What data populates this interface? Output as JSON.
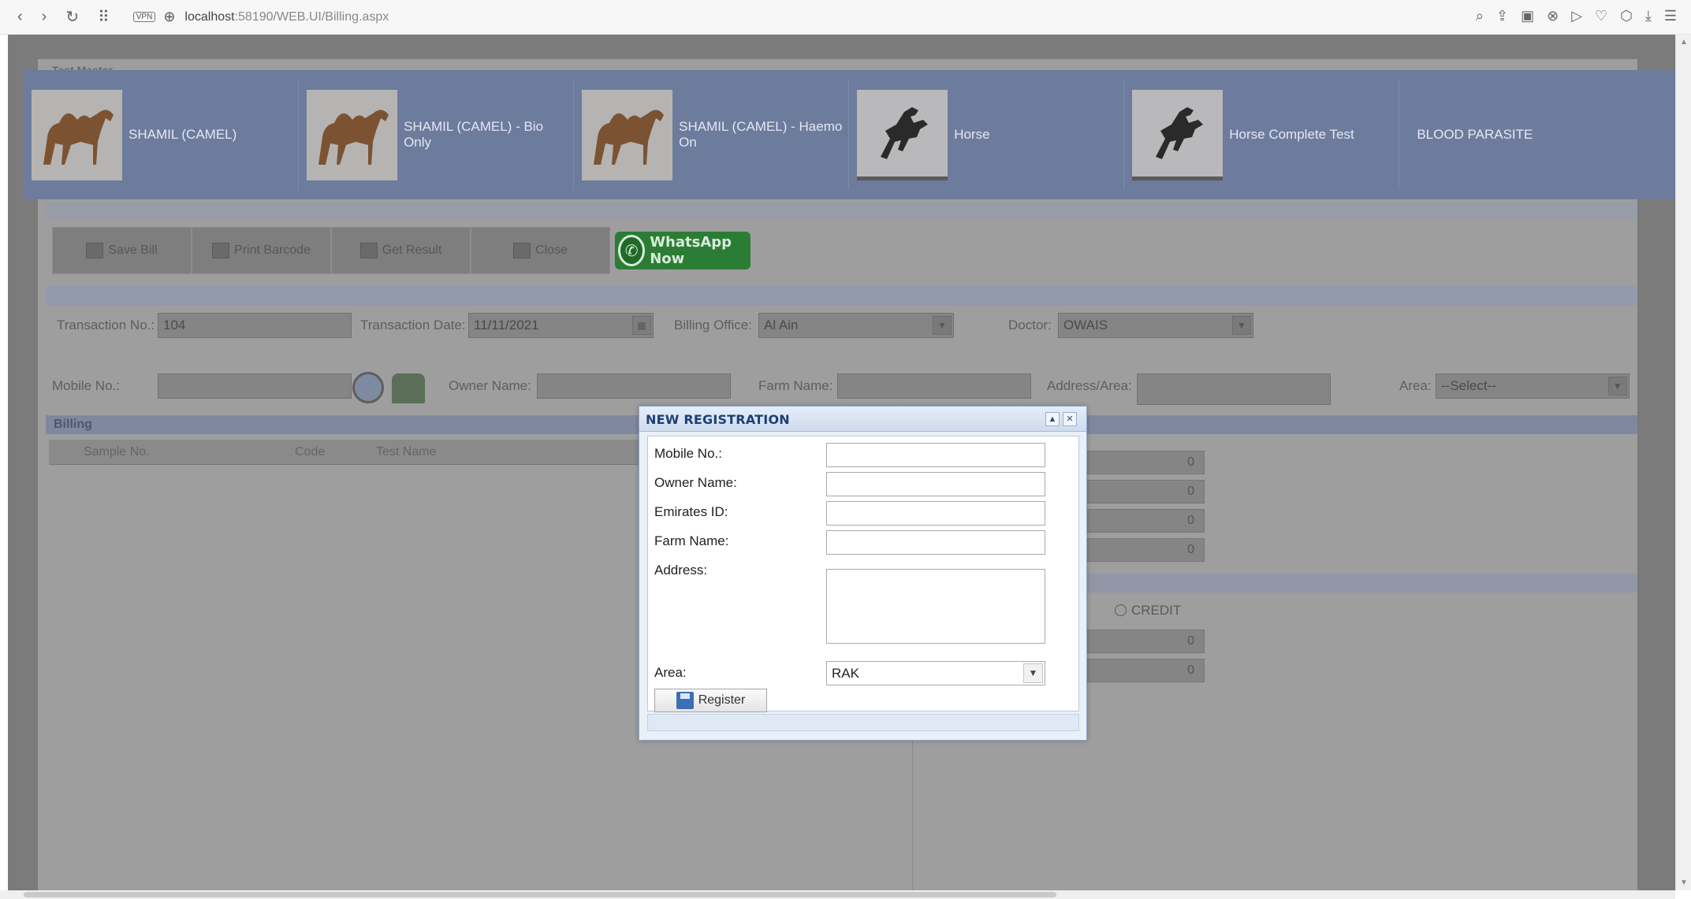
{
  "browser": {
    "url_host": "localhost",
    "url_rest": ":58190/WEB.UI/Billing.aspx",
    "vpn_label": "VPN"
  },
  "panel_title": "Test Master",
  "tests": [
    {
      "label": "SHAMIL (CAMEL)",
      "icon": "camel-image"
    },
    {
      "label": "SHAMIL (CAMEL) - Bio Only",
      "icon": "camel-image"
    },
    {
      "label": "SHAMIL (CAMEL) - Haemo On",
      "icon": "camel-image"
    },
    {
      "label": "Horse",
      "icon": "horse-image"
    },
    {
      "label": "Horse Complete Test",
      "icon": "horse-image"
    },
    {
      "label": "BLOOD PARASITE",
      "icon": ""
    }
  ],
  "toolbar": {
    "save": "Save Bill",
    "print": "Print Barcode",
    "result": "Get Result",
    "close": "Close",
    "whatsapp": "WhatsApp Now"
  },
  "form": {
    "transaction_no_label": "Transaction No.:",
    "transaction_no": "104",
    "transaction_date_label": "Transaction Date:",
    "transaction_date": "11/11/2021",
    "billing_office_label": "Billing Office:",
    "billing_office": "Al Ain",
    "doctor_label": "Doctor:",
    "doctor": "OWAIS",
    "mobile_label": "Mobile No.:",
    "owner_label": "Owner Name:",
    "farm_label": "Farm Name:",
    "address_label": "Address/Area:",
    "area_label": "Area:",
    "area": "--Select--"
  },
  "billing": {
    "title": "Billing",
    "columns": [
      "Sample No.",
      "Code",
      "Test Name"
    ]
  },
  "totals": [
    "0",
    "0",
    "0",
    "0"
  ],
  "payment": {
    "credit_label": "CREDIT",
    "values": [
      "0",
      "0"
    ]
  },
  "modal": {
    "title": "NEW REGISTRATION",
    "mobile_label": "Mobile No.:",
    "owner_label": "Owner Name:",
    "emirates_label": "Emirates ID:",
    "farm_label": "Farm Name:",
    "address_label": "Address:",
    "area_label": "Area:",
    "area_value": "RAK",
    "register_label": "Register",
    "collapse_glyph": "▲",
    "close_glyph": "✕"
  }
}
